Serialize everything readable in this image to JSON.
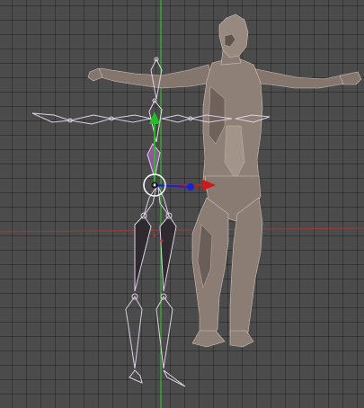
{
  "viewport": {
    "view": "front",
    "grid": true,
    "colors": {
      "background": "#4b4b4b",
      "grid": "#3b3b3b",
      "y_axis": "#32c832",
      "x_axis": "#9a3c3c",
      "armature_wire": "#d8c8e0",
      "armature_selected": "#f0c6f0",
      "mesh_skin": "#8f8077",
      "mesh_edge": "#c9bdb3",
      "gizmo_red": "#d01818",
      "gizmo_green": "#20c020",
      "gizmo_blue": "#1a20d8"
    },
    "objects": [
      {
        "type": "armature",
        "name_shown": ""
      },
      {
        "type": "mesh",
        "name_shown": ""
      }
    ],
    "widgets": [
      "translate-gizmo",
      "3d-cursor"
    ]
  }
}
